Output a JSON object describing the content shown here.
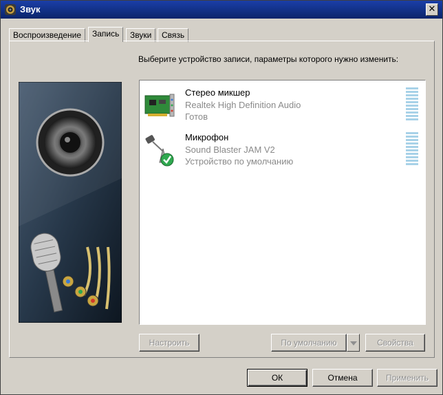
{
  "window": {
    "title": "Звук",
    "close_glyph": "✕"
  },
  "tabs": [
    {
      "label": "Воспроизведение"
    },
    {
      "label": "Запись",
      "active": true
    },
    {
      "label": "Звуки"
    },
    {
      "label": "Связь"
    }
  ],
  "prompt": "Выберите устройство записи, параметры которого нужно изменить:",
  "devices": [
    {
      "name": "Стерео микшер",
      "line1": "Realtek High Definition Audio",
      "line2": "Готов",
      "icon": "sound-card-icon",
      "default": false
    },
    {
      "name": "Микрофон",
      "line1": "Sound Blaster JAM V2",
      "line2": "Устройство по умолчанию",
      "icon": "microphone-icon",
      "default": true
    }
  ],
  "buttons": {
    "configure": "Настроить",
    "set_default": "По умолчанию",
    "properties": "Свойства",
    "ok": "ОК",
    "cancel": "Отмена",
    "apply": "Применить"
  },
  "colors": {
    "titlebar": "#0a246a",
    "meter": "#a8d2e8",
    "face": "#d4d0c8"
  }
}
